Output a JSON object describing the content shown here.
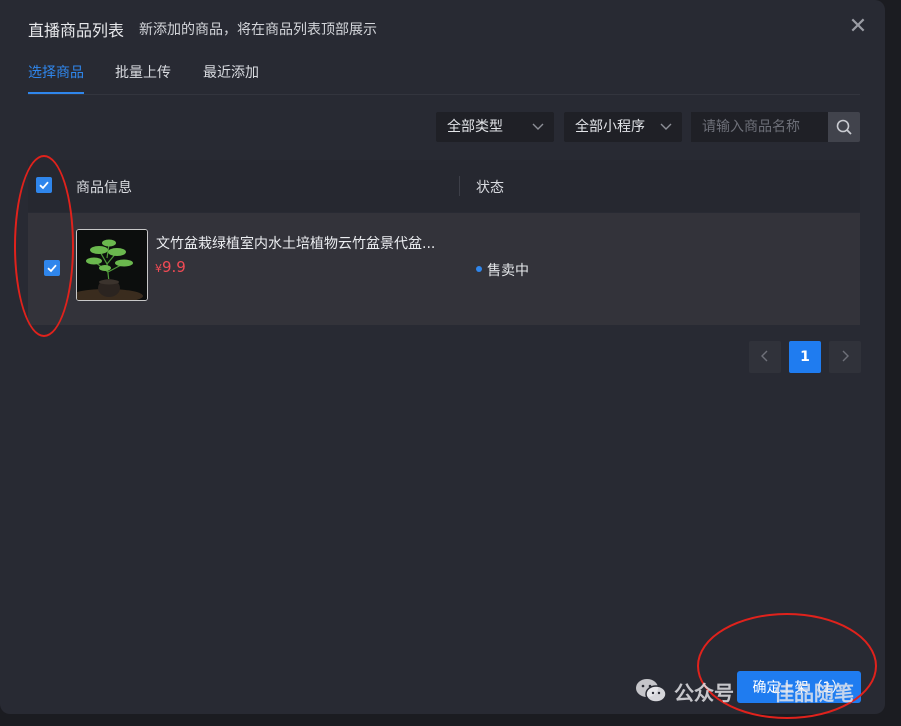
{
  "dialog": {
    "title": "直播商品列表",
    "subtitle": "新添加的商品，将在商品列表顶部展示",
    "close_icon": "close-icon"
  },
  "tabs": [
    {
      "label": "选择商品",
      "active": true
    },
    {
      "label": "批量上传",
      "active": false
    },
    {
      "label": "最近添加",
      "active": false
    }
  ],
  "filters": {
    "type_select": "全部类型",
    "miniprogram_select": "全部小程序",
    "search_placeholder": "请输入商品名称",
    "search_icon": "search-icon"
  },
  "table": {
    "columns": [
      "商品信息",
      "状态"
    ],
    "header_checked": true,
    "rows": [
      {
        "checked": true,
        "name": "文竹盆栽绿植室内水土培植物云竹盆景代盆...",
        "currency": "¥",
        "price": "9.9",
        "status": "售卖中"
      }
    ]
  },
  "pagination": {
    "prev_icon": "chevron-left-icon",
    "current_page": "1",
    "next_icon": "chevron-right-icon"
  },
  "confirm_button": "确定上架（1）",
  "watermark": {
    "text_a": "公众号",
    "text_b": "佳品随笔",
    "icon": "wechat-icon"
  },
  "colors": {
    "accent": "#1f7cf0",
    "price": "#f04a54",
    "annotation": "#e0221c",
    "dialog_bg": "#282a33"
  }
}
